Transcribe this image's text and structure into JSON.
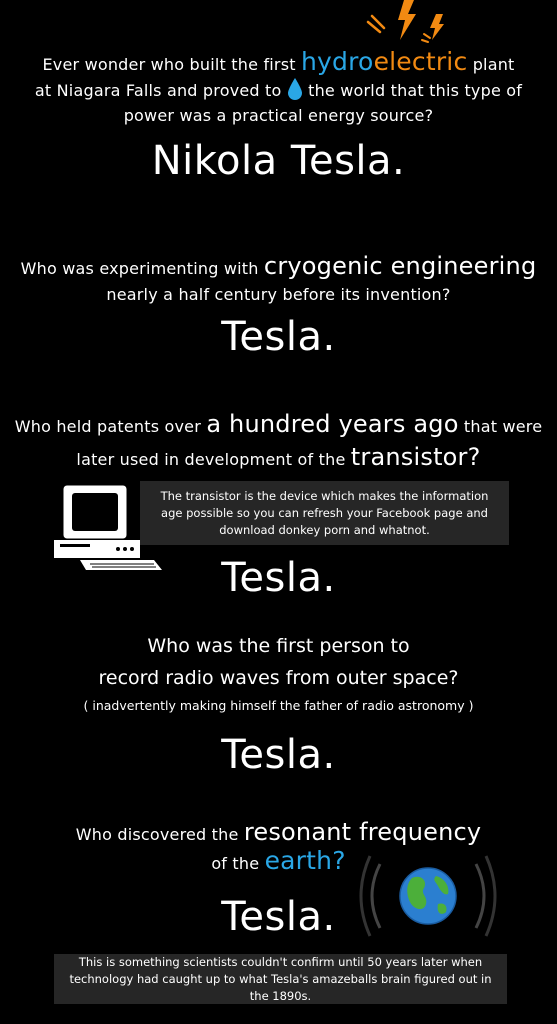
{
  "colors": {
    "background": "#000000",
    "text": "#ffffff",
    "hydro_blue": "#2aa7e6",
    "electric_orange": "#f28a12",
    "earth_blue": "#2aa7e6",
    "note_bg": "#262626"
  },
  "section1": {
    "line1_pre": "Ever wonder who built the first",
    "hydro": "hydro",
    "electric": "electric",
    "line1_post": "plant",
    "line2_pre": "at Niagara Falls and proved to",
    "line2_post": "the world that this type of",
    "line3": "power was a practical energy source?",
    "answer": "Nikola Tesla."
  },
  "section2": {
    "line1_pre": "Who was experimenting with",
    "line1_em": "cryogenic engineering",
    "line2": "nearly a half century before its invention?",
    "answer": "Tesla."
  },
  "section3": {
    "line1_pre": "Who held patents over",
    "line1_em": "a hundred years ago",
    "line1_post": "that were",
    "line2_pre": "later used in development of the",
    "line2_em": "transistor?",
    "note": "The transistor is the device which makes the information age possible so you can refresh your Facebook page and download donkey porn and whatnot.",
    "answer": "Tesla."
  },
  "section4": {
    "line1": "Who was the first person to",
    "line2": "record radio waves from outer space?",
    "line3": "( inadvertently making himself the father of radio astronomy )",
    "answer": "Tesla."
  },
  "section5": {
    "line1_pre": "Who discovered the",
    "line1_em": "resonant frequency",
    "line2_pre": "of the",
    "line2_em": "earth?",
    "answer": "Tesla.",
    "note": "This is something scientists couldn't confirm until 50 years later when technology had caught up to what Tesla's amazeballs brain figured out in the 1890s."
  },
  "icons": [
    "lightning-icon",
    "water-drop-icon",
    "computer-icon",
    "earth-globe-icon",
    "radio-waves-icon"
  ]
}
